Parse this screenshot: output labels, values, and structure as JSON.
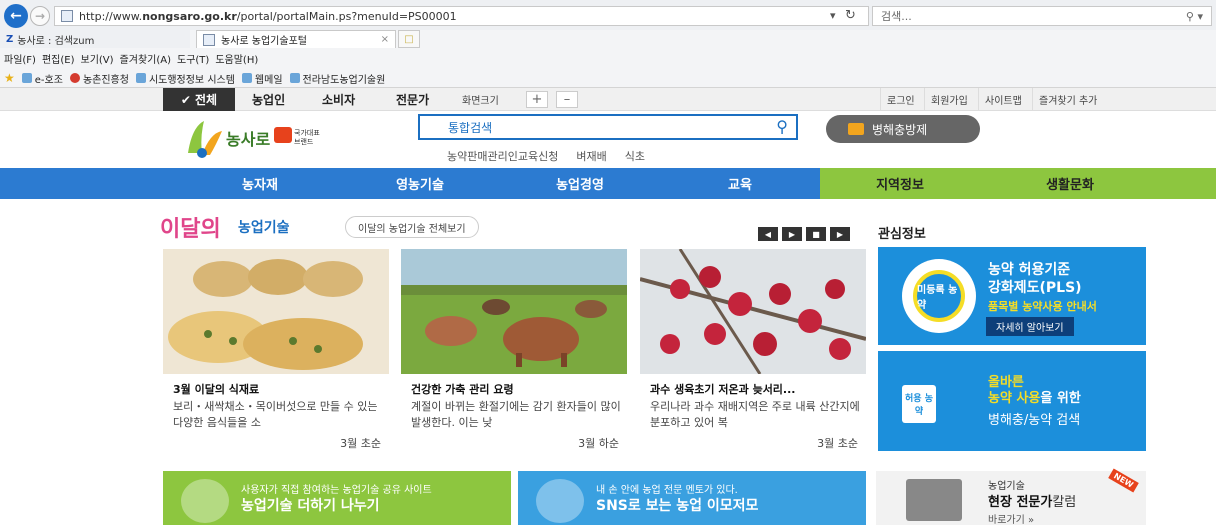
{
  "browser": {
    "url": "http://www.nongsaro.go.kr/portal/portalMain.ps?menuId=PS00001",
    "url_parts": {
      "pre": "http://www.",
      "host": "nongsaro.go.kr",
      "post": "/portal/portalMain.ps?menuId=PS00001"
    },
    "search_placeholder": "검색...",
    "tabs": [
      {
        "label": "농사로 : 검색zum"
      },
      {
        "label": "농사로 농업기술포털"
      }
    ],
    "menu": [
      "파일(F)",
      "편집(E)",
      "보기(V)",
      "즐겨찾기(A)",
      "도구(T)",
      "도움말(H)"
    ],
    "favorites": [
      "e-호조",
      "농촌진흥청",
      "시도행정정보 시스템",
      "웹메일",
      "전라남도농업기술원"
    ]
  },
  "utilbar": {
    "all": "전체",
    "items": [
      "농업인",
      "소비자",
      "전문가"
    ],
    "zoom_label": "화면크기",
    "right": [
      "로그인",
      "회원가입",
      "사이트맵",
      "즐겨찾기 추가"
    ]
  },
  "header": {
    "logo_text": "농사로",
    "brand_text": "국가대표 브랜드",
    "search_placeholder": "통합검색",
    "quick_links": [
      "농약판매관리인교육신청",
      "벼재배",
      "식초"
    ],
    "pest_button": "병해충방제"
  },
  "gnb": [
    "농자재",
    "영농기술",
    "농업경영",
    "교육",
    "지역정보",
    "생활문화"
  ],
  "section": {
    "title_pre": "이달의",
    "title": "농업기술",
    "view_all": "이달의 농업기술 전체보기",
    "interest_title": "관심정보"
  },
  "cards": [
    {
      "title": "3월 이달의 식재료",
      "desc": "보리・새싹채소・목이버섯으로 만들 수 있는 다양한 음식들을 소",
      "date": "3월 초순"
    },
    {
      "title": "건강한 가축 관리 요령",
      "desc": "계절이 바뀌는 환절기에는 감기 환자들이 많이 발생한다. 이는 낮",
      "date": "3월 하순"
    },
    {
      "title": "과수 생육초기 저온과 늦서리...",
      "desc": "우리나라 과수 재배지역은 주로 내륙 산간지에 분포하고 있어 복",
      "date": "3월 초순"
    }
  ],
  "pls_banner": {
    "badge": "미등록 농약",
    "line1": "농약 허용기준",
    "line2": "강화제도(PLS)",
    "line3": "품목별 농약사용 안내서",
    "more": "자세히 알아보기"
  },
  "pest_banner": {
    "badge": "허용 농약",
    "line1": "올바른",
    "line2_a": "농약 사용",
    "line2_b": "을 위한",
    "line3": "병해충/농약 검색"
  },
  "bottom_banners": [
    {
      "sub": "사용자가 직접 참여하는 농업기술 공유 사이트",
      "main": "농업기술 더하기 나누기"
    },
    {
      "sub": "내 손 안에 농업 전문 멘토가 있다.",
      "main": "SNS로 보는 농업 이모저모"
    },
    {
      "sub": "농업기술",
      "main_a": "현장 전문가",
      "main_b": "칼럼",
      "go": "바로가기 »",
      "badge": "NEW"
    }
  ]
}
